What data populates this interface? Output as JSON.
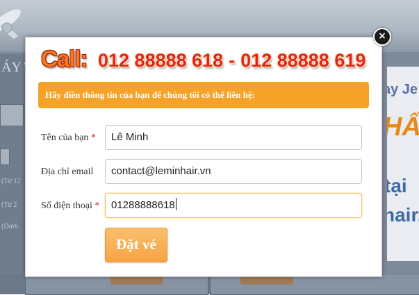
{
  "background": {
    "left_title": "ÁY T",
    "left_options": [
      "(Từ 12",
      "(Từ 2",
      "(Dưới"
    ],
    "right_texts": [
      "ay Je",
      "HẤT",
      "tại",
      "hair.v"
    ]
  },
  "modal": {
    "close_label": "×",
    "call_label": "Call:",
    "phone_1": "012 88888 618",
    "separator": "-",
    "phone_2": "012 88888 619",
    "instruction": "Hãy điền thông tin của bạn để chúng tôi có thể liên hệ:",
    "required_mark": "*",
    "fields": {
      "name": {
        "label": "Tên của bạn",
        "value": "Lê Minh",
        "required": true
      },
      "email": {
        "label": "Địa chỉ email",
        "value": "contact@leminhair.vn",
        "required": false
      },
      "phone": {
        "label": "Số điện thoại",
        "value": "01288888618",
        "required": true
      }
    },
    "submit_label": "Đặt vé"
  },
  "colors": {
    "accent_orange": "#f4a328",
    "call_red": "#e2241c",
    "required_red": "#d9251d"
  },
  "icons": {
    "close": "close-icon"
  }
}
